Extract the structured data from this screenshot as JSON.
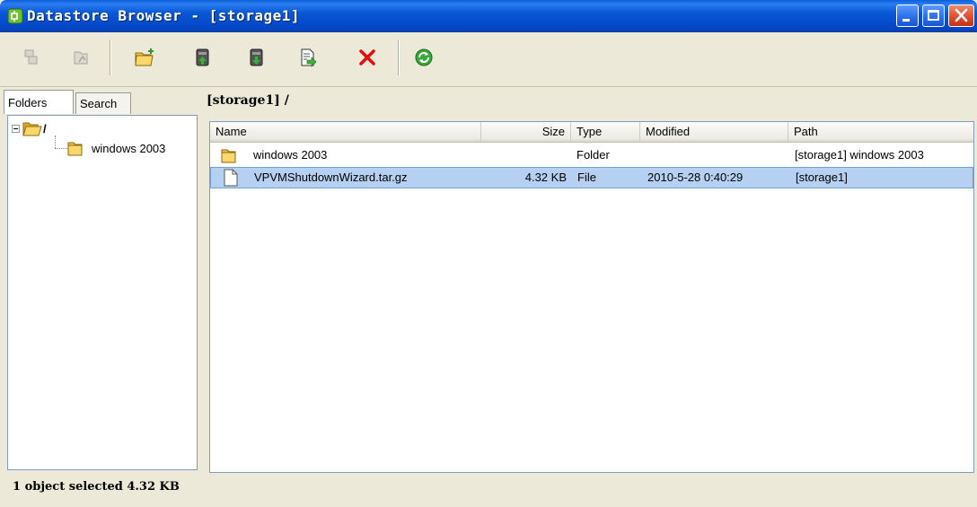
{
  "window": {
    "title": "Datastore Browser - [storage1]",
    "title_color": "#0858d6"
  },
  "toolbar": {
    "buttons": [
      {
        "icon": "datastore-icon",
        "enabled": false
      },
      {
        "icon": "browse-up-icon",
        "enabled": false
      },
      {
        "icon": "new-folder-icon",
        "enabled": true
      },
      {
        "icon": "upload-icon",
        "enabled": true
      },
      {
        "icon": "download-icon",
        "enabled": true
      },
      {
        "icon": "register-vm-icon",
        "enabled": true
      },
      {
        "icon": "delete-icon",
        "enabled": true
      },
      {
        "icon": "refresh-icon",
        "enabled": true
      }
    ]
  },
  "sidebar": {
    "tabs": [
      {
        "label": "Folders",
        "active": true
      },
      {
        "label": "Search",
        "active": false
      }
    ],
    "tree": {
      "root_label": "/",
      "children": [
        {
          "label": "windows 2003"
        }
      ]
    }
  },
  "main": {
    "current_path": "[storage1] /",
    "columns": [
      "Name",
      "Size",
      "Type",
      "Modified",
      "Path"
    ],
    "rows": [
      {
        "name": "windows 2003",
        "size": "",
        "type": "Folder",
        "modified": "",
        "path": "[storage1] windows 2003",
        "icon": "folder-icon",
        "selected": false
      },
      {
        "name": "VPVMShutdownWizard.tar.gz",
        "size": "4.32 KB",
        "type": "File",
        "modified": "2010-5-28 0:40:29",
        "path": "[storage1]",
        "icon": "file-icon",
        "selected": true
      }
    ]
  },
  "status": {
    "text": "1 object selected 4.32 KB"
  },
  "colors": {
    "selection": "#b5d0f0",
    "folder": "#f5c242",
    "delete": "#e01010",
    "refresh": "#3aa83a"
  }
}
